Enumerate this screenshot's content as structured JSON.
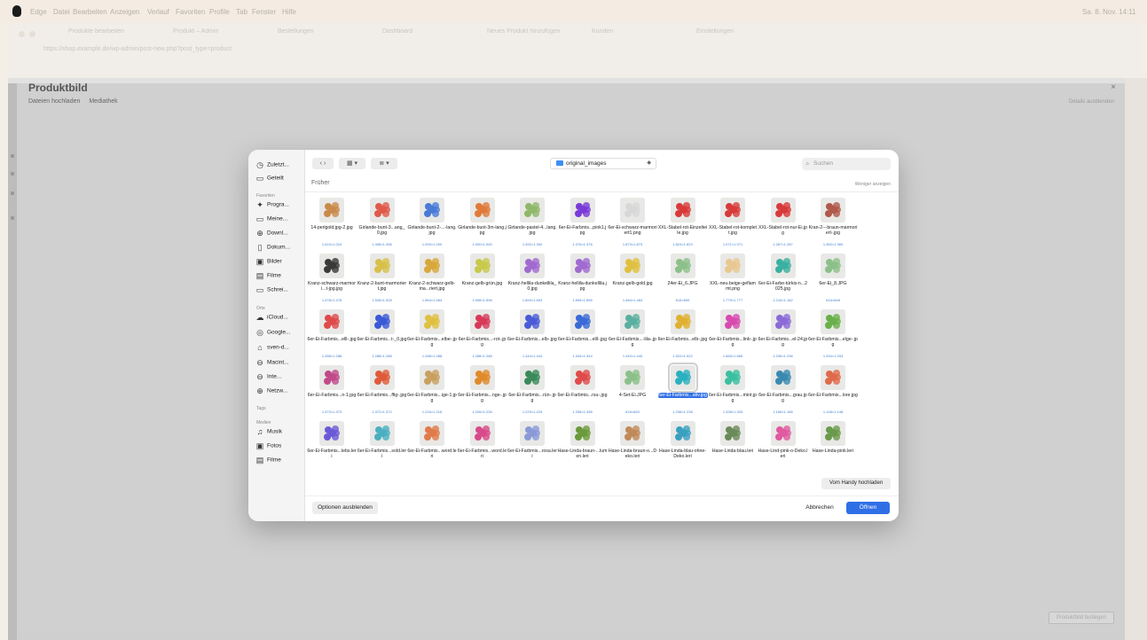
{
  "menubar": {
    "app_name": "Edge",
    "items": [
      "Datei",
      "Bearbeiten",
      "Anzeigen",
      "Verlauf",
      "Favoriten",
      "Profile",
      "Tab",
      "Fenster",
      "Hilfe"
    ],
    "clock": "Sa. 8. Nov. 14:11"
  },
  "browser": {
    "tabs": [
      "Produkte bearbeiten",
      "Produkt – Admin",
      "Bestellungen",
      "Dashboard",
      "Neues Produkt hinzufügen",
      "Kunden",
      "Einstellungen"
    ],
    "url": "https://shop.example.de/wp-admin/post-new.php?post_type=product"
  },
  "modal": {
    "title": "Produktbild",
    "tab_upload": "Dateien hochladen",
    "tab_library": "Mediathek",
    "details_link": "Details ausblenden",
    "set_button": "Produktbild festlegen"
  },
  "dialog": {
    "folder": "original_images",
    "search_placeholder": "Suchen",
    "section": "Früher",
    "show_less": "Weniger anzeigen",
    "handy_button": "Vom Handy hochladen",
    "options_button": "Optionen ausblenden",
    "cancel_button": "Abbrechen",
    "open_button": "Öffnen",
    "sidebar": {
      "recent": "Zuletzt...",
      "shared": "Geteilt",
      "favorites_heading": "Favoriten",
      "favorites": [
        "Progra...",
        "Meine...",
        "Downl...",
        "Dokum...",
        "Bilder",
        "Filme",
        "Schrei..."
      ],
      "locations_heading": "Orte",
      "locations": [
        "iCloud...",
        "Google...",
        "sven-d...",
        "Macint...",
        "Inte...",
        "Netzw..."
      ],
      "tags_heading": "Tags",
      "media_heading": "Medien",
      "media": [
        "Musik",
        "Fotos",
        "Filme"
      ]
    }
  },
  "files": [
    {
      "name": "14-perlgold.jpg-2.jpg",
      "dims": "1.024×1.024",
      "color": "#c98a4a"
    },
    {
      "name": "Girlande-bunt-3...ang_0.jpg",
      "dims": "1.498×1.498",
      "color": "#e05a4a"
    },
    {
      "name": "Girlande-bunt-2-...-lang.jpg",
      "dims": "1.000×1.000",
      "color": "#4a7ad8"
    },
    {
      "name": "Girlande-bunt-3m-lang.jpg",
      "dims": "1.000×1.000",
      "color": "#e07a3a"
    },
    {
      "name": "Girlande-pastel-4...lang.jpg",
      "dims": "1.392×1.392",
      "color": "#8fb86a"
    },
    {
      "name": "6er-Ei-Farbmis...pink1.jpg",
      "dims": "1.376×1.376",
      "color": "#7a3ad8"
    },
    {
      "name": "6er-Ei-schwarz-marmoriert1.png",
      "dims": "1.873×1.873",
      "color": "#d8d8d8"
    },
    {
      "name": "XXL-Stabel-rot-Einzelteile.jpg",
      "dims": "1.823×1.823",
      "color": "#d83a3a"
    },
    {
      "name": "XXL-Stabel-rot-komplett.jpg",
      "dims": "1.071×1.071",
      "color": "#d83a3a"
    },
    {
      "name": "XXL-Stabel-rot-nur-Ei.jpg",
      "dims": "1.287×1.287",
      "color": "#d83a3a"
    },
    {
      "name": "Kran-2---braun-marmoriert-.jpg",
      "dims": "1.360×1.360",
      "color": "#b0584a"
    },
    {
      "name": "Kranz-schwarz-marmori...t-jpg.jpg",
      "dims": "1.478×1.478",
      "color": "#3a3a3a"
    },
    {
      "name": "Kranz-2-bunt-marmoriert.jpg",
      "dims": "1.528×1.528",
      "color": "#d8c04a"
    },
    {
      "name": "Kranz-2-schwarz-gelb-ma...riert.jpg",
      "dims": "1.564×1.564",
      "color": "#d8a83a"
    },
    {
      "name": "Kranz-gelb-grün.jpg",
      "dims": "1.598×1.598",
      "color": "#c8c84a"
    },
    {
      "name": "Kranz-hellila-dunkellila_0.jpg",
      "dims": "1.893×1.893",
      "color": "#a06ad0"
    },
    {
      "name": "Kranz-hellila-dunkellila.jpg",
      "dims": "1.895×1.895",
      "color": "#a06ad0"
    },
    {
      "name": "Kranz-gelb-gold.jpg",
      "dims": "1.484×1.484",
      "color": "#e0c040"
    },
    {
      "name": "24er-Ei_6.JPG",
      "dims": "615×659",
      "color": "#8cc08a"
    },
    {
      "name": "XXL-neu-beige-geflammt.png",
      "dims": "1.779×1.777",
      "color": "#e8c890"
    },
    {
      "name": "6er-Ei-Farbe-türkis-n...2025.jpg",
      "dims": "1.218×1.182",
      "color": "#3ab0a0"
    },
    {
      "name": "6er-Ei_8.JPG",
      "dims": "616×648",
      "color": "#8cc08a"
    },
    {
      "name": "6er-Ei-Farbmis...elll-.jpg",
      "dims": "1.288×1.288",
      "color": "#e04a4a"
    },
    {
      "name": "6er-Ei-Farbmis...t-_0.jpg",
      "dims": "1.288×1.288",
      "color": "#3a5ad8"
    },
    {
      "name": "6er-Ei-Farbmis...elbe-.jpg",
      "dims": "1.288×1.288",
      "color": "#e0c040"
    },
    {
      "name": "6er-Ei-Farbmis...-rot-.jpg",
      "dims": "1.288×1.288",
      "color": "#d83a5a"
    },
    {
      "name": "6er-Ei-Farbmis...elb-.jpg",
      "dims": "1.444×1.444",
      "color": "#4a5ad8"
    },
    {
      "name": "6er-Ei-Farbmis...elll-.jpg",
      "dims": "1.344×1.344",
      "color": "#3a6ad8"
    },
    {
      "name": "6er-Ei-Farbmis...-lila-.jpg",
      "dims": "1.440×1.440",
      "color": "#5ab0a0"
    },
    {
      "name": "6er-Ei-Farbmis...elb-.jpg",
      "dims": "1.522×1.522",
      "color": "#e0b030"
    },
    {
      "name": "6er-Ei-Farbmis...link-.jpg",
      "dims": "1.665×1.665",
      "color": "#d84ab0"
    },
    {
      "name": "6er-Ei-Farbmis...el-24.jpg",
      "dims": "1.236×1.236",
      "color": "#8a6ad8"
    },
    {
      "name": "6er-Ei-Farbmis...elge-.jpg",
      "dims": "1.334×1.333",
      "color": "#6ab04a"
    },
    {
      "name": "6er-Ei-Farbmis...n-1.jpg",
      "dims": "1.373×1.373",
      "color": "#c04a8a"
    },
    {
      "name": "6er-Ei-Farbmis...ffig-.jpg",
      "dims": "1.372×1.372",
      "color": "#e05a3a"
    },
    {
      "name": "6er-Ei-Farbmis...ige-1.jpg",
      "dims": "1.216×1.216",
      "color": "#c8a060"
    },
    {
      "name": "6er-Ei-Farbmis...nge-.jpg",
      "dims": "1.226×1.226",
      "color": "#e08a2a"
    },
    {
      "name": "6er-Ei-Farbmis...rün-.jpg",
      "dims": "1.229×1.229",
      "color": "#3a8a5a"
    },
    {
      "name": "6er-Ei-Farbmis...rsu-.jpg",
      "dims": "1.338×1.338",
      "color": "#e04a4a"
    },
    {
      "name": "4-Set-Ei.JPG",
      "dims": "616×663",
      "color": "#8cc08a"
    },
    {
      "name": "6er-Ei-Farbmis...ativ.jpg",
      "dims": "1.238×1.238",
      "color": "#2ab0c0",
      "selected": true
    },
    {
      "name": "6er-Ei-Farbmis...mint.jpg",
      "dims": "1.338×1.333",
      "color": "#3ac0a0"
    },
    {
      "name": "6er-Ei-Farbmis...grau.jpg",
      "dims": "1.166×1.166",
      "color": "#3a8ab0"
    },
    {
      "name": "6er-Ei-Farbmis...lore.jpg",
      "dims": "1.148×1.148",
      "color": "#e06a4a"
    },
    {
      "name": "6er-Ei-Farbmis...lebs.leri",
      "dims": "",
      "color": "#6a5ad8"
    },
    {
      "name": "6er-Ei-Farbmis...sold.leri",
      "dims": "",
      "color": "#4ab0c0"
    },
    {
      "name": "6er-Ei-Farbmis...word.leri",
      "dims": "",
      "color": "#e07a4a"
    },
    {
      "name": "6er-Ei-Farbmis...word.leri",
      "dims": "",
      "color": "#d84a8a"
    },
    {
      "name": "6er-Ei-Farbmis...rosa.leri",
      "dims": "",
      "color": "#8a9ad8"
    },
    {
      "name": "Hase-Linda-braun-...lumen.leri",
      "dims": "",
      "color": "#6a9a3a"
    },
    {
      "name": "Hase-Linda-braun-o...Deko.leri",
      "dims": "",
      "color": "#c08a5a"
    },
    {
      "name": "Hase-Linda-blau-ohne-Deko.leri",
      "dims": "",
      "color": "#3aa0c0"
    },
    {
      "name": "Hase-Linda-blau.leri",
      "dims": "",
      "color": "#6a8a5a"
    },
    {
      "name": "Hase-Lind-pink-o-Deko.leri",
      "dims": "",
      "color": "#e05aa0"
    },
    {
      "name": "Hase-Linda-pink.leri",
      "dims": "",
      "color": "#6a9a4a"
    }
  ]
}
